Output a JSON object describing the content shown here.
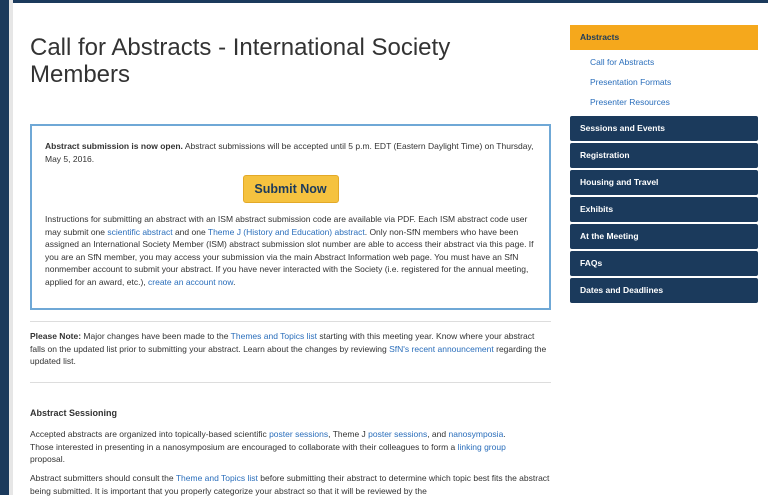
{
  "page_title": "Call for Abstracts - International Society Members",
  "notice": {
    "bold_lead": "Abstract submission is now open.",
    "lead_text": " Abstract submissions will be accepted until 5 p.m. EDT (Eastern Daylight Time) on Thursday, May 5, 2016.",
    "submit_label": "Submit Now",
    "body_1": "Instructions for submitting an abstract with an ISM abstract submission code are available via PDF. Each ISM abstract code user may submit one ",
    "link_scientific": "scientific abstract",
    "body_2": " and one ",
    "link_theme_j": "Theme J (History and Education) abstract",
    "body_3": ". Only non-SfN members who have been assigned an International Society Member (ISM) abstract submission slot number are able to access their abstract via this page. If you are an SfN member, you may access your submission via the main Abstract Information web page. You must have an SfN nonmember account to submit your abstract. If you have never interacted with the Society (i.e. registered for the annual meeting, applied for an award, etc.), ",
    "link_create": "create an account now",
    "body_4": "."
  },
  "please_note": {
    "bold_lead": "Please Note:",
    "text_1": " Major changes have been made to the ",
    "link_themes": "Themes and Topics list",
    "text_2": " starting with this meeting year. Know where your abstract falls on the updated list prior to submitting your abstract. Learn about the changes by reviewing ",
    "link_announcement": "SfN's recent announcement",
    "text_3": " regarding the updated list."
  },
  "sessioning": {
    "title": "Abstract Sessioning",
    "p1_text_1": "Accepted abstracts are organized into topically-based scientific ",
    "p1_link_poster": "poster sessions",
    "p1_text_2": ", Theme J ",
    "p1_link_poster_j": "poster sessions",
    "p1_text_3": ", and ",
    "p1_link_nano": "nanosymposia",
    "p1_text_4": ". Those interested in presenting in a nanosymposium are encouraged to collaborate with their colleagues to form a ",
    "p1_link_group": "linking group",
    "p1_text_5": " proposal.",
    "p2_text_1": "Abstract submitters should consult the ",
    "p2_link_themes": "Theme and Topics list",
    "p2_text_2": " before submitting their abstract to determine which topic best fits the abstract being submitted. It is important that you properly categorize your abstract so that it will be reviewed by the"
  },
  "sidebar": {
    "active": "Abstracts",
    "subitems": [
      "Call for Abstracts",
      "Presentation Formats",
      "Presenter Resources"
    ],
    "items": [
      "Sessions and Events",
      "Registration",
      "Housing and Travel",
      "Exhibits",
      "At the Meeting",
      "FAQs",
      "Dates and Deadlines"
    ]
  },
  "colors": {
    "navy": "#1b3a5c",
    "orange": "#f5a81c",
    "button_yellow": "#f5c23f",
    "link_blue": "#2a6ebb",
    "notice_border": "#6fa8d6"
  }
}
